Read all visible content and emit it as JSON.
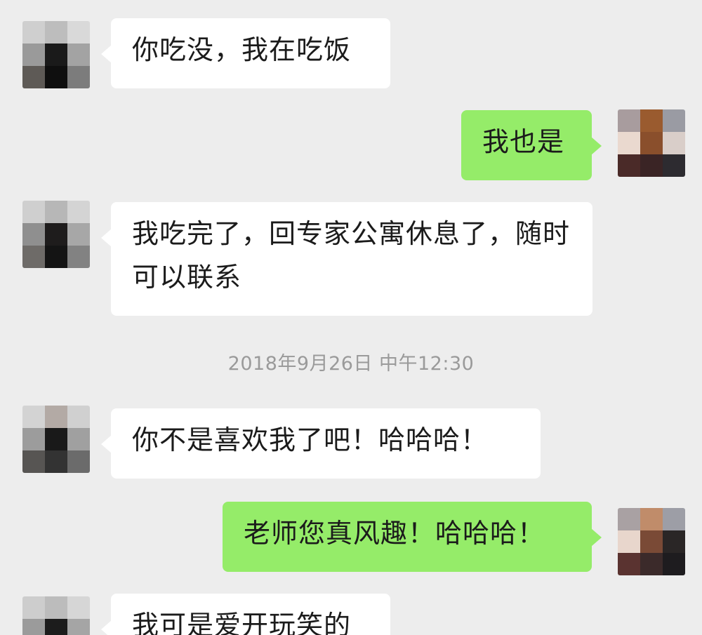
{
  "colors": {
    "background": "#ededed",
    "incoming_bubble": "#ffffff",
    "outgoing_bubble": "#95ec69",
    "timestamp_text": "#9a9a9a"
  },
  "messages": [
    {
      "side": "left",
      "text": "你吃没，我在吃饭"
    },
    {
      "side": "right",
      "text": "我也是"
    },
    {
      "side": "left",
      "text": "我吃完了，回专家公寓休息了，随时可以联系"
    },
    {
      "side": "left",
      "text": "你不是喜欢我了吧！哈哈哈！"
    },
    {
      "side": "right",
      "text": "老师您真风趣！哈哈哈！"
    },
    {
      "side": "left",
      "text": "我可是爱开玩笑的"
    }
  ],
  "timestamp": "2018年9月26日 中午12:30"
}
